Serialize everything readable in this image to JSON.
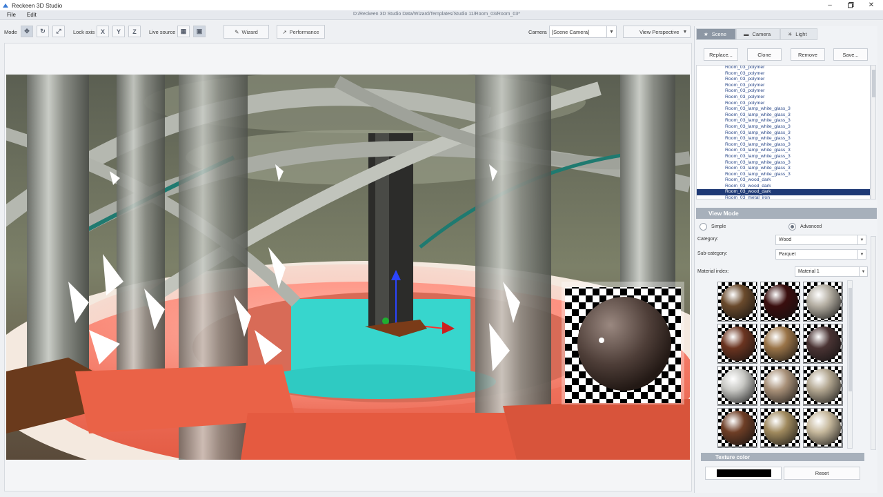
{
  "window": {
    "title": "Reckeen 3D Studio",
    "file_path": "D:/Reckeen 3D Studio Data/Wizard/Templates/Studio 11/Room_03/Room_03*"
  },
  "menu": [
    "File",
    "Edit"
  ],
  "toolbar": {
    "mode_label": "Mode",
    "lock_axis_label": "Lock axis",
    "lock_axes": [
      "X",
      "Y",
      "Z"
    ],
    "live_source_label": "Live source",
    "wizard_label": "Wizard",
    "performance_label": "Performance",
    "camera_label": "Camera",
    "camera_value": "[Scene Camera]",
    "view_mode_value": "View Perspective"
  },
  "panel": {
    "tabs": [
      {
        "label": "Scene",
        "icon": "star-icon",
        "active": true
      },
      {
        "label": "Camera",
        "icon": "camera-icon",
        "active": false
      },
      {
        "label": "Light",
        "icon": "sun-icon",
        "active": false
      }
    ],
    "actions": [
      "Replace...",
      "Clone",
      "Remove",
      "Save..."
    ],
    "objects": [
      "Room_03_polymer",
      "Room_03_polymer",
      "Room_03_polymer",
      "Room_03_polymer",
      "Room_03_polymer",
      "Room_03_polymer",
      "Room_03_polymer",
      "Room_03_lamp_white_glass_3",
      "Room_03_lamp_white_glass_3",
      "Room_03_lamp_white_glass_3",
      "Room_03_lamp_white_glass_3",
      "Room_03_lamp_white_glass_3",
      "Room_03_lamp_white_glass_3",
      "Room_03_lamp_white_glass_3",
      "Room_03_lamp_white_glass_3",
      "Room_03_lamp_white_glass_3",
      "Room_03_lamp_white_glass_3",
      "Room_03_lamp_white_glass_3",
      "Room_03_lamp_white_glass_3",
      "Room_03_wood_dark",
      "Room_03_wood_dark",
      "Room_03_wood_dark",
      "Room_03_metal_iron"
    ],
    "selected_index": 21,
    "view_mode": {
      "title": "View Mode",
      "simple_label": "Simple",
      "advanced_label": "Advanced",
      "selected": "Advanced"
    },
    "category_label": "Category:",
    "category_value": "Wood",
    "subcategory_label": "Sub-category:",
    "subcategory_value": "Parquet",
    "material_index_label": "Material index:",
    "material_index_value": "Material 1",
    "materials": [
      "#6a4a2c",
      "#3a0e0e",
      "#b4aea2",
      "#6b3420",
      "#9a7448",
      "#4a3434",
      "#c8c8c4",
      "#a89078",
      "#b2a690",
      "#6e3e26",
      "#a08a5e",
      "#c6b89c"
    ],
    "texture_color_title": "Texture color",
    "texture_color_value": "#000000",
    "reset_label": "Reset"
  },
  "colors": {
    "accent_selected": "#1f3a76",
    "section_header": "#a7b0bb",
    "tab_active": "#8d97a4"
  }
}
